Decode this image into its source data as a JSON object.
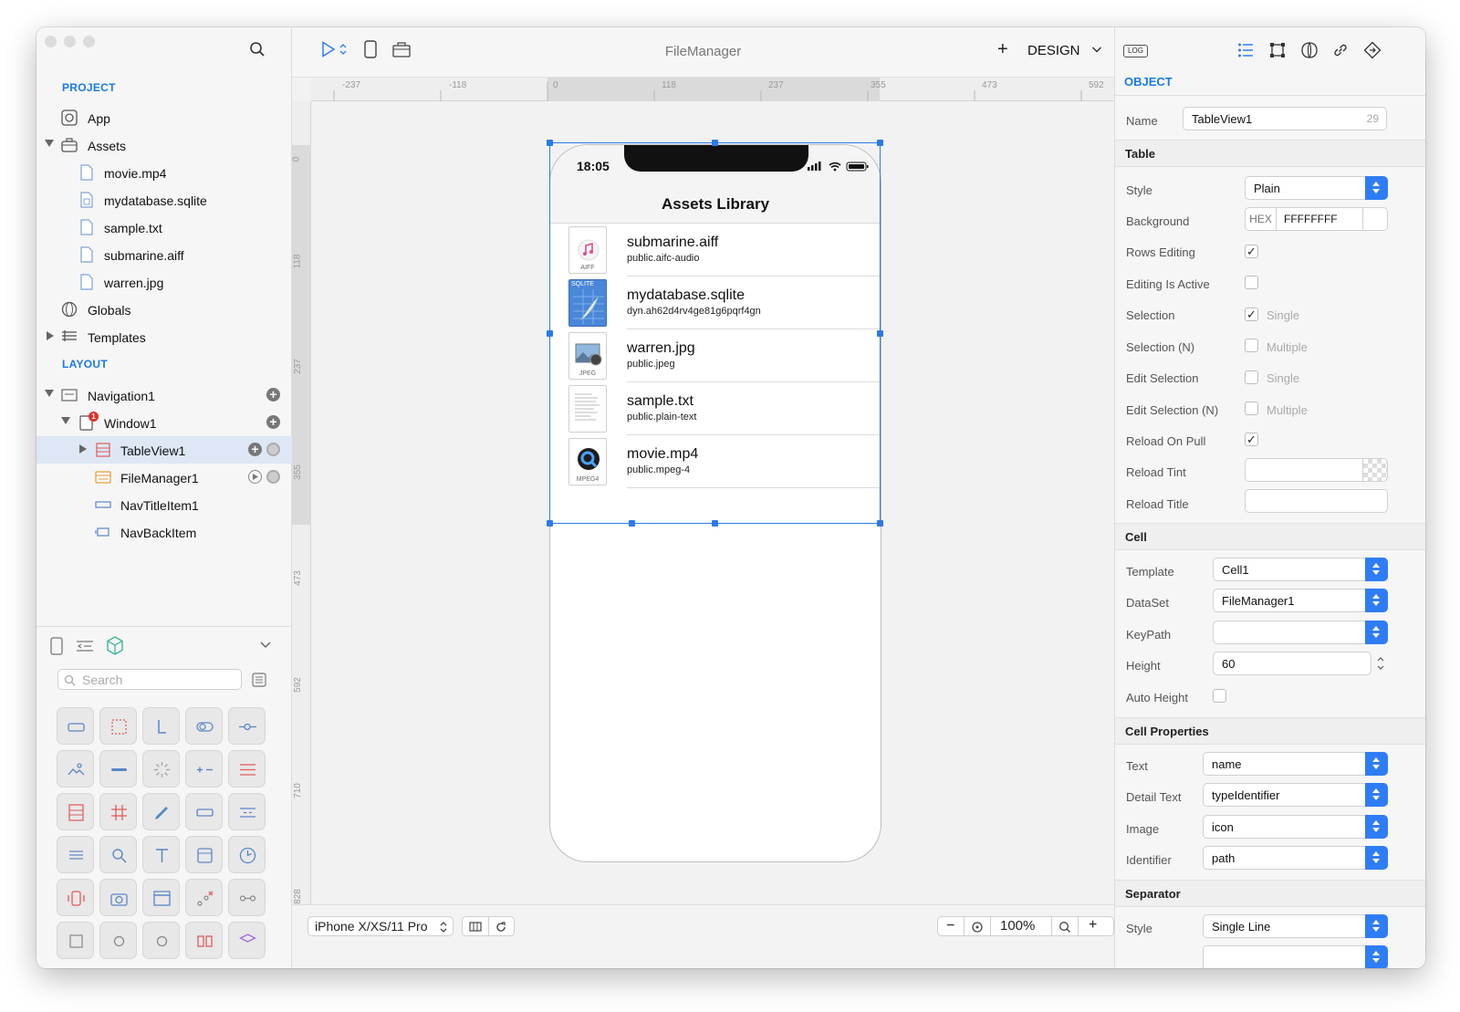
{
  "window": {
    "title": "FileManager"
  },
  "sidebar": {
    "project_heading": "PROJECT",
    "project_items": [
      {
        "label": "App",
        "icon": "app-icon"
      },
      {
        "label": "Assets",
        "icon": "briefcase-icon"
      },
      {
        "label": "movie.mp4",
        "icon": "file-icon"
      },
      {
        "label": "mydatabase.sqlite",
        "icon": "database-file-icon"
      },
      {
        "label": "sample.txt",
        "icon": "file-icon"
      },
      {
        "label": "submarine.aiff",
        "icon": "file-icon"
      },
      {
        "label": "warren.jpg",
        "icon": "file-icon"
      },
      {
        "label": "Globals",
        "icon": "globe-icon"
      },
      {
        "label": "Templates",
        "icon": "templates-icon"
      }
    ],
    "layout_heading": "LAYOUT",
    "layout_items": [
      {
        "label": "Navigation1",
        "icon": "navigation-icon"
      },
      {
        "label": "Window1",
        "icon": "window-icon",
        "badge": "1"
      },
      {
        "label": "TableView1",
        "icon": "tableview-icon"
      },
      {
        "label": "FileManager1",
        "icon": "filemanager-icon"
      },
      {
        "label": "NavTitleItem1",
        "icon": "navtitle-icon"
      },
      {
        "label": "NavBackItem",
        "icon": "navback-icon"
      }
    ],
    "search_placeholder": "Search"
  },
  "ruler": {
    "h_ticks": [
      "-237",
      "-118",
      "0",
      "118",
      "237",
      "355",
      "473",
      "592"
    ],
    "v_ticks": [
      "0",
      "118",
      "237",
      "355",
      "473",
      "592",
      "710",
      "828"
    ]
  },
  "toolbar": {
    "add_label": "+",
    "mode_label": "DESIGN"
  },
  "phone": {
    "time": "18:05",
    "nav_title": "Assets Library",
    "rows": [
      {
        "title": "submarine.aiff",
        "subtitle": "public.aifc-audio",
        "tag": "AIFF"
      },
      {
        "title": "mydatabase.sqlite",
        "subtitle": "dyn.ah62d4rv4ge81g6pqrf4gn",
        "tag": "SQLITE"
      },
      {
        "title": "warren.jpg",
        "subtitle": "public.jpeg",
        "tag": "JPEG"
      },
      {
        "title": "sample.txt",
        "subtitle": "public.plain-text",
        "tag": ""
      },
      {
        "title": "movie.mp4",
        "subtitle": "public.mpeg-4",
        "tag": "MPEG4"
      }
    ]
  },
  "bottombar": {
    "device": "iPhone X/XS/11 Pro",
    "zoom": "100%",
    "minus": "−",
    "plus": "+"
  },
  "inspector": {
    "log_label": "LOG",
    "object_heading": "OBJECT",
    "name_label": "Name",
    "name_value": "TableView1",
    "name_count": "29",
    "table_heading": "Table",
    "style_label": "Style",
    "style_value": "Plain",
    "background_label": "Background",
    "hex_label": "HEX",
    "hex_value": "FFFFFFFF",
    "rows_editing_label": "Rows Editing",
    "editing_active_label": "Editing Is Active",
    "selection_label": "Selection",
    "selection_value": "Single",
    "selection_n_label": "Selection (N)",
    "selection_n_value": "Multiple",
    "edit_selection_label": "Edit Selection",
    "edit_selection_value": "Single",
    "edit_selection_n_label": "Edit Selection (N)",
    "edit_selection_n_value": "Multiple",
    "reload_pull_label": "Reload On Pull",
    "reload_tint_label": "Reload Tint",
    "reload_title_label": "Reload Title",
    "cell_heading": "Cell",
    "template_label": "Template",
    "template_value": "Cell1",
    "dataset_label": "DataSet",
    "dataset_value": "FileManager1",
    "keypath_label": "KeyPath",
    "keypath_value": "",
    "height_label": "Height",
    "height_value": "60",
    "auto_height_label": "Auto Height",
    "cell_props_heading": "Cell Properties",
    "text_label": "Text",
    "text_value": "name",
    "detail_label": "Detail Text",
    "detail_value": "typeIdentifier",
    "image_label": "Image",
    "image_value": "icon",
    "identifier_label": "Identifier",
    "identifier_value": "path",
    "separator_heading": "Separator",
    "sep_style_label": "Style",
    "sep_style_value": "Single Line"
  },
  "colors": {
    "accent": "#1a7ae6",
    "stepper": "#2f7df6",
    "selection": "#dde7f5",
    "badge": "#e0302a",
    "handle": "#2c7ae8"
  }
}
